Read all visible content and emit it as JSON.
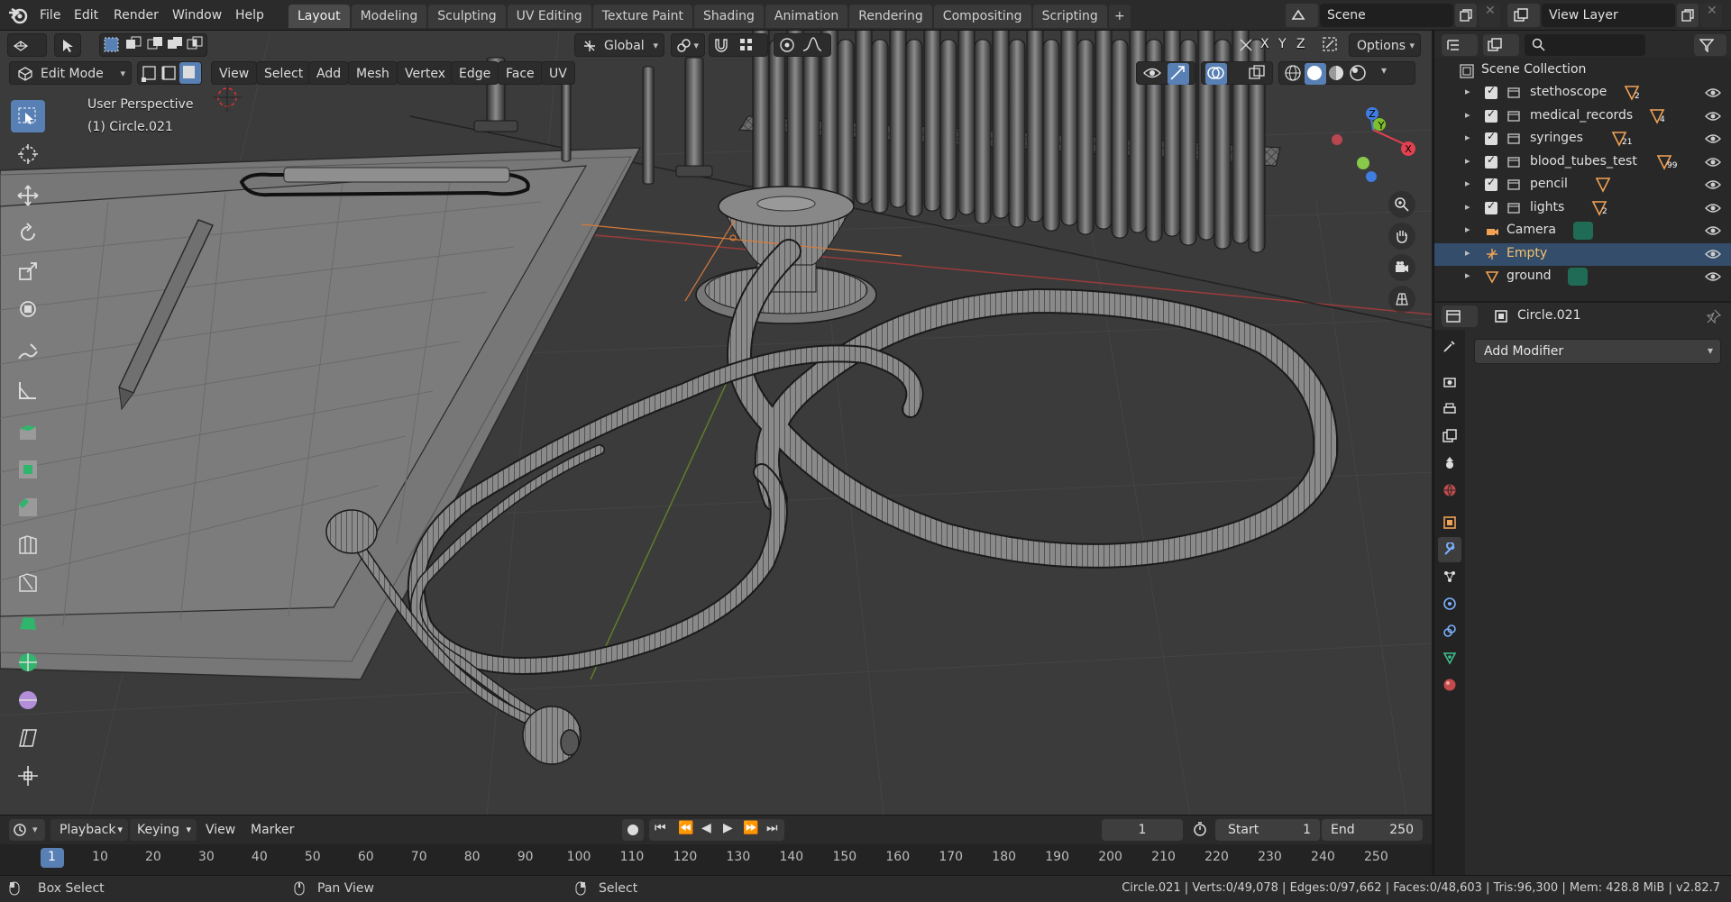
{
  "topbar": {
    "menus": [
      "File",
      "Edit",
      "Render",
      "Window",
      "Help"
    ],
    "workspaces": [
      "Layout",
      "Modeling",
      "Sculpting",
      "UV Editing",
      "Texture Paint",
      "Shading",
      "Animation",
      "Rendering",
      "Compositing",
      "Scripting"
    ],
    "active_workspace": "Layout",
    "add_tab": "+",
    "scene": "Scene",
    "view_layer": "View Layer"
  },
  "viewport": {
    "transform_orientation": "Global",
    "axis_labels": [
      "X",
      "Y",
      "Z"
    ],
    "options_label": "Options",
    "mode": "Edit Mode",
    "menus": [
      "View",
      "Select",
      "Add",
      "Mesh",
      "Vertex",
      "Edge",
      "Face",
      "UV"
    ],
    "perspective_label": "User Perspective",
    "object_label": "(1) Circle.021",
    "gizmo_axes": {
      "x": "X",
      "y": "Y",
      "z": "Z"
    },
    "colors": {
      "x_axis": "#e2414f",
      "y_axis": "#7fbf2d",
      "z_axis": "#3f7de0",
      "bg": "#3b3b3b"
    }
  },
  "timeline": {
    "menus": [
      "Playback",
      "Keying",
      "View",
      "Marker"
    ],
    "current_frame": "1",
    "start_label": "Start",
    "start_value": "1",
    "end_label": "End",
    "end_value": "250",
    "ruler_ticks": [
      "1",
      "10",
      "20",
      "30",
      "40",
      "50",
      "60",
      "70",
      "80",
      "90",
      "100",
      "110",
      "120",
      "130",
      "140",
      "150",
      "160",
      "170",
      "180",
      "190",
      "200",
      "210",
      "220",
      "230",
      "240",
      "250"
    ]
  },
  "statusbar": {
    "left_action": "Box Select",
    "middle_action": "Pan View",
    "right_action": "Select",
    "stats": "Circle.021 | Verts:0/49,078 | Edges:0/97,662 | Faces:0/48,603 | Tris:96,300 | Mem: 428.8 MiB | v2.82.7"
  },
  "outliner": {
    "root": "Scene Collection",
    "items": [
      {
        "label": "stethoscope",
        "kind": "collection",
        "badge": "2"
      },
      {
        "label": "medical_records",
        "kind": "collection",
        "badge": "4"
      },
      {
        "label": "syringes",
        "kind": "collection",
        "badge": "21"
      },
      {
        "label": "blood_tubes_test",
        "kind": "collection",
        "badge": "99"
      },
      {
        "label": "pencil",
        "kind": "collection",
        "badge": ""
      },
      {
        "label": "lights",
        "kind": "collection",
        "badge": "2"
      },
      {
        "label": "Camera",
        "kind": "camera",
        "badge": ""
      },
      {
        "label": "Empty",
        "kind": "empty",
        "badge": ""
      },
      {
        "label": "ground",
        "kind": "mesh",
        "badge": ""
      }
    ]
  },
  "properties": {
    "object_name": "Circle.021",
    "add_modifier_label": "Add Modifier"
  }
}
